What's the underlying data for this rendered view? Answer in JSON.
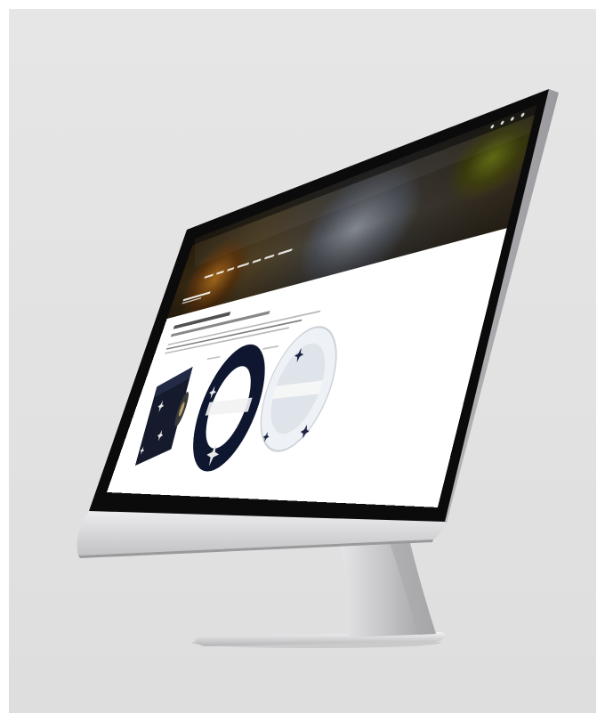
{
  "scene": {
    "description_text": "",
    "background_color": "#e3e3e3",
    "monitor_bezel_color": "#0d0d0d",
    "monitor_chin_color": "#d9d9dc",
    "stand_color": "#c9c9cc"
  },
  "website": {
    "logo_text": "",
    "hero_colors": [
      "#6a3d10",
      "#5a5e66",
      "#7d8a1a"
    ],
    "nav_item_count": 7,
    "products": [
      {
        "name": "placemat-roll",
        "color": "#14192b"
      },
      {
        "name": "navy-plate",
        "color": "#0e1630"
      },
      {
        "name": "white-plate",
        "color": "#f2f4f7"
      }
    ]
  }
}
